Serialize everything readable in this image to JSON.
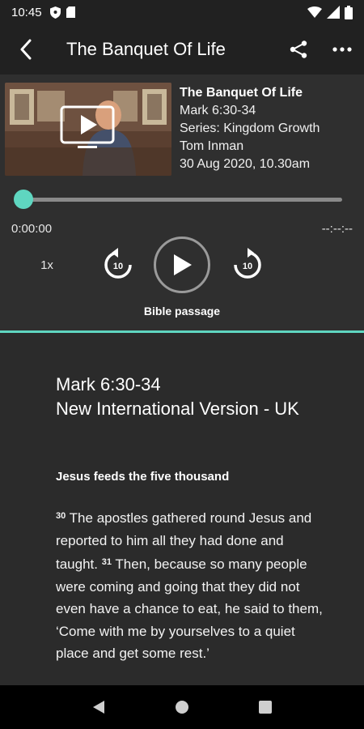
{
  "status": {
    "time": "10:45"
  },
  "appbar": {
    "title": "The Banquet Of Life"
  },
  "sermon": {
    "title": "The Banquet Of Life",
    "reference": "Mark 6:30-34",
    "series": "Series: Kingdom Growth",
    "speaker": "Tom Inman",
    "date": "30 Aug 2020, 10.30am"
  },
  "player": {
    "current_time": "0:00:00",
    "total_time": "--:--:--",
    "speed": "1x",
    "rewind_seconds": "10",
    "forward_seconds": "10",
    "progress": 0,
    "tab_label": "Bible passage"
  },
  "passage": {
    "reference": "Mark 6:30-34",
    "version": "New International Version - UK",
    "heading": "Jesus feeds the five thousand",
    "verses": [
      {
        "num": "30",
        "text": "The apostles gathered round Jesus and reported to him all they had done and taught."
      },
      {
        "num": "31",
        "text": "Then, because so many people were coming and going that they did not even have a chance to eat, he said to them, ‘Come with me by yourselves to a quiet place and get some rest.’"
      }
    ]
  },
  "colors": {
    "accent": "#5fd6c0",
    "background": "#2b2b2b",
    "bar": "#212121"
  },
  "icons": [
    "back-arrow-icon",
    "share-icon",
    "more-icon",
    "video-icon",
    "rewind-10-icon",
    "play-icon",
    "forward-10-icon",
    "nav-back-icon",
    "nav-home-icon",
    "nav-recents-icon"
  ]
}
